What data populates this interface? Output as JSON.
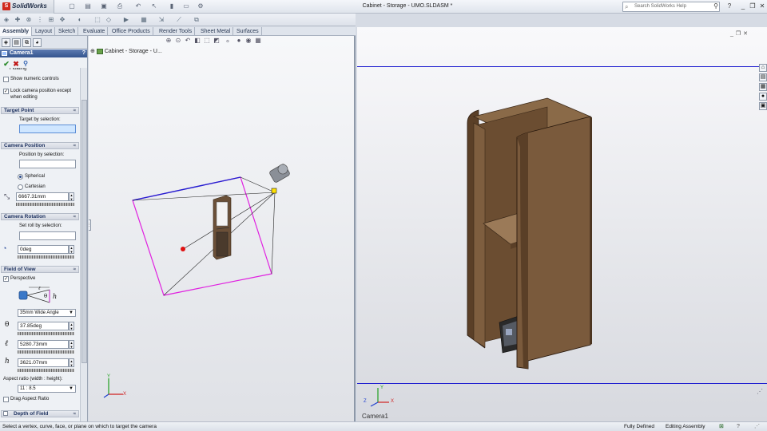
{
  "app": {
    "brand": "SolidWorks",
    "doc_title": "Cabinet - Storage - UMO.SLDASM *",
    "help_search_placeholder": "Search SolidWorks Help"
  },
  "tabs": [
    "Assembly",
    "Layout",
    "Sketch",
    "Evaluate",
    "Office Products",
    "Render Tools",
    "Sheet Metal",
    "Surfaces"
  ],
  "active_tab": "Assembly",
  "property_manager": {
    "title": "Camera1",
    "help": "?",
    "truncated_option": "Floating",
    "show_numeric_controls": "Show numeric controls",
    "lock_camera": "Lock camera position except when editing",
    "target_point": {
      "header": "Target Point",
      "label": "Target by selection:"
    },
    "camera_position": {
      "header": "Camera Position",
      "label": "Position by selection:",
      "spherical": "Spherical",
      "cartesian": "Cartesian",
      "distance": "6667.31mm"
    },
    "camera_rotation": {
      "header": "Camera Rotation",
      "label": "Set roll by selection:",
      "roll": "0deg"
    },
    "field_of_view": {
      "header": "Field of View",
      "perspective": "Perspective",
      "lens": "35mm Wide Angle",
      "theta_symbol": "θ",
      "theta": "37.85deg",
      "ell_symbol": "ℓ",
      "ell": "5280.73mm",
      "h_symbol": "h",
      "h": "3621.07mm",
      "aspect_label": "Aspect ratio (width : height):",
      "aspect": "11 : 8.5",
      "drag_aspect": "Drag Aspect Ratio"
    },
    "depth_of_field": {
      "header": "Depth of Field"
    }
  },
  "left_view": {
    "tree_root": "Cabinet - Storage - U..."
  },
  "right_view": {
    "label": "Camera1"
  },
  "triad": {
    "x": "X",
    "y": "Y",
    "z": "Z"
  },
  "status": {
    "message": "Select a vertex, curve, face, or plane on which to target the camera",
    "fully_defined": "Fully Defined",
    "editing": "Editing Assembly"
  },
  "colors": {
    "frustum_blue": "#2020d0",
    "frustum_magenta": "#e020e0",
    "target_red": "#e01010",
    "wood": "#7a5a3c",
    "wood_dark": "#5a3f27",
    "wood_light": "#9b7a58"
  }
}
